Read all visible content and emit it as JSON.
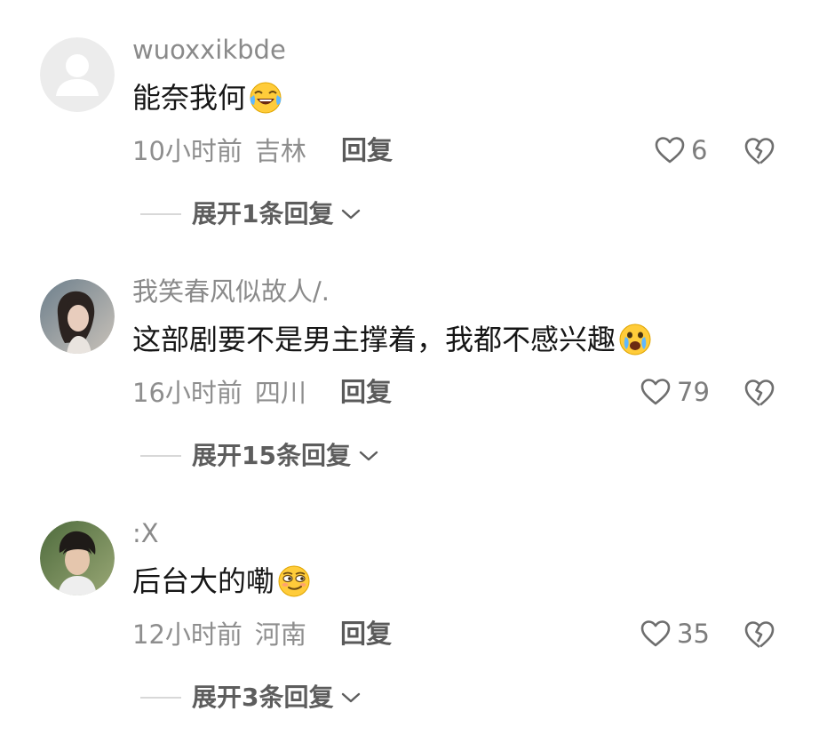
{
  "comments": [
    {
      "username": "wuoxxikbde",
      "text": "能奈我何",
      "emoji": "tears-of-joy-emoji",
      "time": "10小时前",
      "location": "吉林",
      "reply_label": "回复",
      "likes": "6",
      "expand_label": "展开1条回复"
    },
    {
      "username": "我笑春风似故人/.",
      "text": "这部剧要不是男主撑着，我都不感兴趣",
      "emoji": "crying-laughing-emoji",
      "time": "16小时前",
      "location": "四川",
      "reply_label": "回复",
      "likes": "79",
      "expand_label": "展开15条回复"
    },
    {
      "username": ":X",
      "text": "后台大的嘞",
      "emoji": "smirk-emoji",
      "time": "12小时前",
      "location": "河南",
      "reply_label": "回复",
      "likes": "35",
      "expand_label": "展开3条回复"
    }
  ],
  "colors": {
    "username": "#8a8a8a",
    "body": "#161616",
    "meta": "#8e8e8e",
    "reply": "#5a5a5a",
    "icon": "#6e6e6e"
  }
}
